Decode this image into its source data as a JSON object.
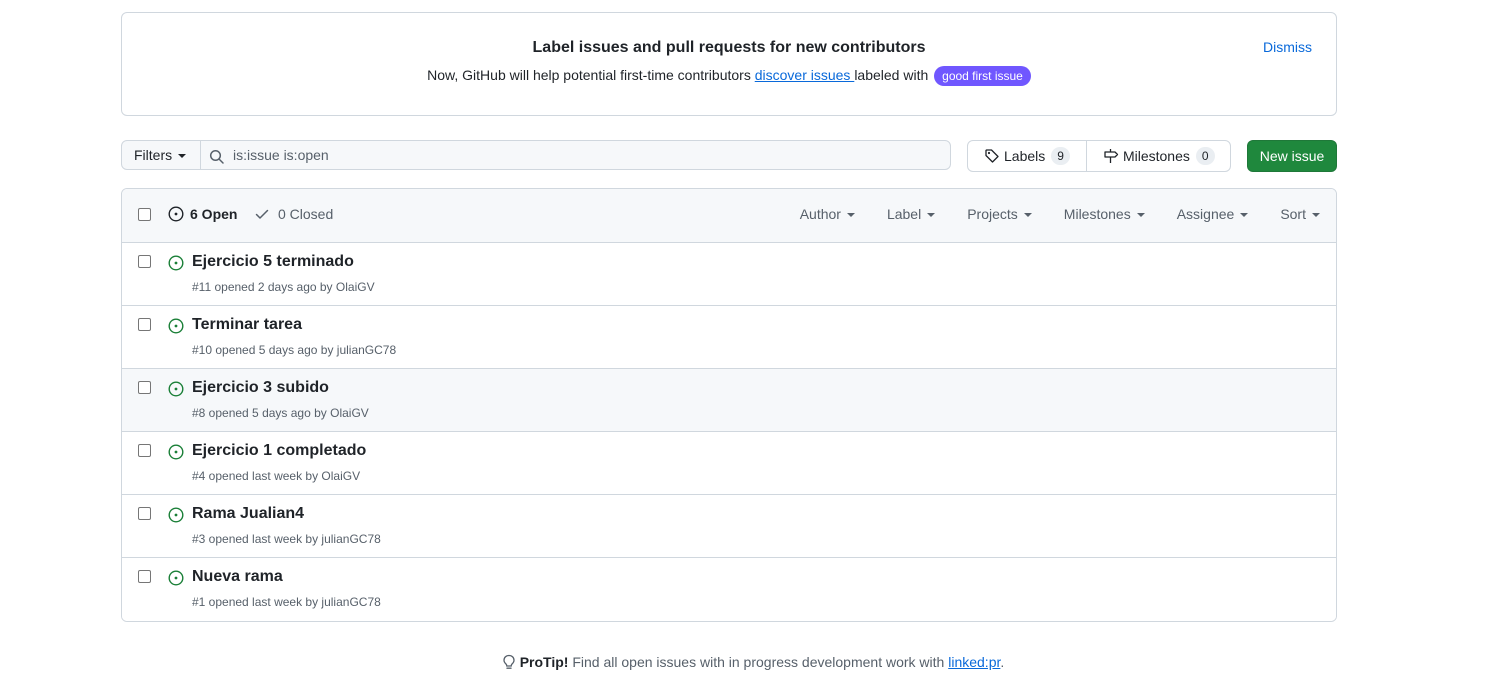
{
  "banner": {
    "title": "Label issues and pull requests for new contributors",
    "text_before": "Now, GitHub will help potential first-time contributors ",
    "link": "discover issues ",
    "text_after": "labeled with ",
    "label": "good first issue",
    "dismiss": "Dismiss"
  },
  "toolbar": {
    "filters_label": "Filters",
    "search_value": "is:issue is:open",
    "labels_label": "Labels",
    "labels_count": "9",
    "milestones_label": "Milestones",
    "milestones_count": "0",
    "new_issue_label": "New issue"
  },
  "list_header": {
    "open_label": "6 Open",
    "closed_label": "0 Closed",
    "filters": [
      "Author",
      "Label",
      "Projects",
      "Milestones",
      "Assignee",
      "Sort"
    ]
  },
  "issues": [
    {
      "title": "Ejercicio 5 terminado",
      "meta": "#11 opened 2 days ago by OlaiGV"
    },
    {
      "title": "Terminar tarea",
      "meta": "#10 opened 5 days ago by julianGC78"
    },
    {
      "title": "Ejercicio 3 subido",
      "meta": "#8 opened 5 days ago by OlaiGV"
    },
    {
      "title": "Ejercicio 1 completado",
      "meta": "#4 opened last week by OlaiGV"
    },
    {
      "title": "Rama Jualian4",
      "meta": "#3 opened last week by julianGC78"
    },
    {
      "title": "Nueva rama",
      "meta": "#1 opened last week by julianGC78"
    }
  ],
  "protip": {
    "bold": "ProTip!",
    "text": " Find all open issues with in progress development work with ",
    "link": "linked:pr",
    "end": "."
  },
  "colors": {
    "accent": "#0969da",
    "open_green": "#1a7f37",
    "button_green": "#1f883d",
    "label_purple": "#7057ff"
  }
}
